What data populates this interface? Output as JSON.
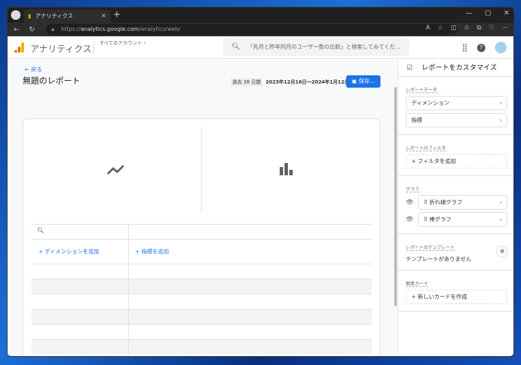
{
  "browser": {
    "tab_title": "アナリティクス",
    "url_prefix": "https://",
    "url_host": "analytics.google.com",
    "url_path": "/analytics/web/"
  },
  "header": {
    "app_title": "アナリティクス",
    "account": "すべてのアカウント",
    "search_placeholder": "「先月と昨年同月のユーザー数の比較」と検索してみてくだ..."
  },
  "report": {
    "back": "戻る",
    "title": "無題のレポート",
    "period": "過去 28 日間",
    "date_range": "2023年12月16日～2024年1月12日",
    "save": "保存..."
  },
  "table": {
    "add_dimension": "ディメンションを追加",
    "add_metric": "指標を追加"
  },
  "panel": {
    "title": "レポートをカスタマイズ",
    "report_data_label": "レポートデータ",
    "dimension": "ディメンション",
    "metric": "指標",
    "filter_label": "レポートのフィルタ",
    "add_filter": "フィルタを追加",
    "graph_label": "グラフ",
    "line_graph": "折れ線グラフ",
    "bar_graph": "棒グラフ",
    "template_label": "レポートのテンプレート",
    "no_template": "テンプレートがありません",
    "summary_label": "概要カード",
    "new_card": "新しいカードを作成"
  }
}
